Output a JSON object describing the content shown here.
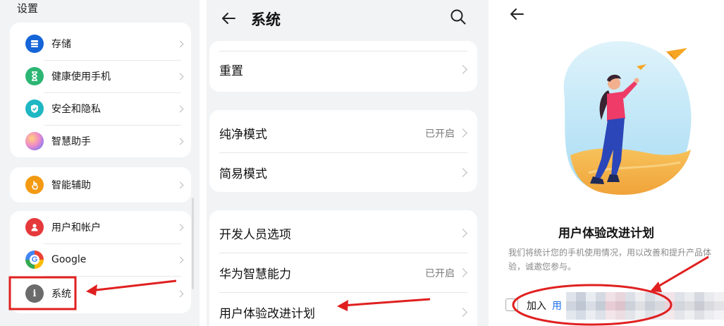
{
  "settings_list": {
    "title": "设置",
    "groups": [
      {
        "items": [
          {
            "label": "存储",
            "icon": "storage-icon",
            "color": "#1565d8"
          },
          {
            "label": "健康使用手机",
            "icon": "hourglass-icon",
            "color": "#2bb673"
          },
          {
            "label": "安全和隐私",
            "icon": "shield-check-icon",
            "color": "#1fb7c4"
          },
          {
            "label": "智慧助手",
            "icon": "assistant-orb-icon",
            "color": "#c56be8"
          }
        ]
      },
      {
        "items": [
          {
            "label": "智能辅助",
            "icon": "hand-pointer-icon",
            "color": "#f39a12"
          }
        ]
      },
      {
        "items": [
          {
            "label": "用户和帐户",
            "icon": "user-icon",
            "color": "#e5383b"
          },
          {
            "label": "Google",
            "icon": "google-icon",
            "color": "#4285f4"
          },
          {
            "label": "系统",
            "icon": "info-icon",
            "color": "#6b6b6b"
          }
        ]
      }
    ]
  },
  "system_page": {
    "title": "系统",
    "groups": [
      {
        "items": [
          {
            "label": "重置",
            "status": ""
          }
        ]
      },
      {
        "items": [
          {
            "label": "纯净模式",
            "status": "已开启"
          },
          {
            "label": "简易模式",
            "status": ""
          }
        ]
      },
      {
        "items": [
          {
            "label": "开发人员选项",
            "status": ""
          },
          {
            "label": "华为智慧能力",
            "status": "已开启"
          },
          {
            "label": "用户体验改进计划",
            "status": ""
          }
        ]
      }
    ]
  },
  "ux_program": {
    "title": "用户体验改进计划",
    "description": "我们将统计您的手机使用情况，用以改善和提升产品体验，诚邀您参与。",
    "join_prefix": "加入",
    "join_link": "用",
    "tail": "‌"
  },
  "annotation_color": "#e02020"
}
